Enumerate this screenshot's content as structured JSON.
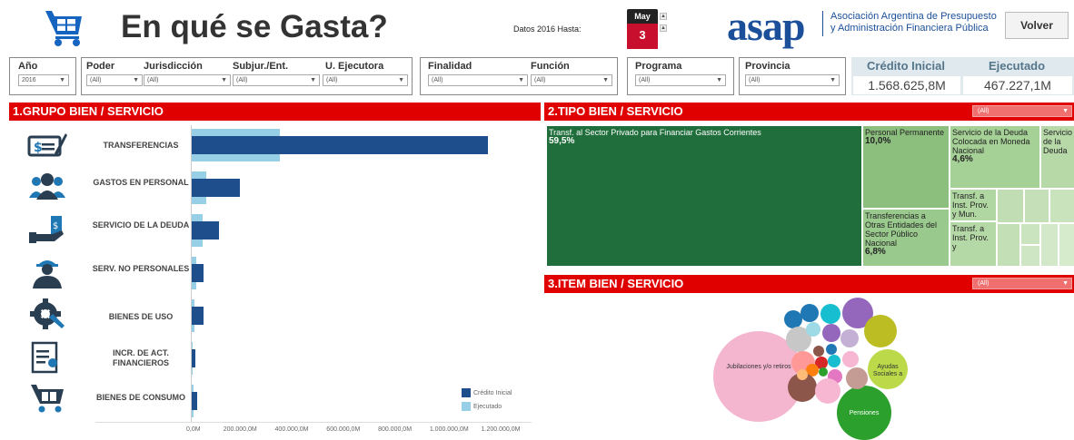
{
  "header": {
    "title": "En qué se Gasta?",
    "date_label": "Datos 2016 Hasta:",
    "calendar": {
      "month": "May",
      "day": "3"
    },
    "org_short": "asap",
    "org_line1": "Asociación Argentina de Presupuesto",
    "org_line2": "y Administración Financiera Pública",
    "back_button": "Volver"
  },
  "filters": {
    "anio": {
      "label": "Año",
      "value": "2016"
    },
    "poder": {
      "label": "Poder",
      "value": "(All)"
    },
    "jurisdiccion": {
      "label": "Jurisdicción",
      "value": "(All)"
    },
    "subjur": {
      "label": "Subjur./Ent.",
      "value": "(All)"
    },
    "uejecutora": {
      "label": "U. Ejecutora",
      "value": "(All)"
    },
    "finalidad": {
      "label": "Finalidad",
      "value": "(All)"
    },
    "funcion": {
      "label": "Función",
      "value": "(All)"
    },
    "programa": {
      "label": "Programa",
      "value": "(All)"
    },
    "provincia": {
      "label": "Provincia",
      "value": "(All)"
    }
  },
  "kpis": {
    "credito_label": "Crédito Inicial",
    "credito_value": "1.568.625,8M",
    "ejecutado_label": "Ejecutado",
    "ejecutado_value": "467.227,1M"
  },
  "section1": {
    "title": "1.GRUPO BIEN / SERVICIO",
    "categories": [
      {
        "label": "TRANSFERENCIAS",
        "icon": "check-icon"
      },
      {
        "label": "GASTOS EN PERSONAL",
        "icon": "people-icon"
      },
      {
        "label": "SERVICIO DE LA DEUDA",
        "icon": "money-hand-icon"
      },
      {
        "label": "SERV. NO PERSONALES",
        "icon": "worker-icon"
      },
      {
        "label": "BIENES DE USO",
        "icon": "gear-wrench-icon"
      },
      {
        "label": "INCR. DE ACT. FINANCIEROS",
        "icon": "certificate-icon"
      },
      {
        "label": "BIENES DE CONSUMO",
        "icon": "cart-icon"
      }
    ],
    "legend": {
      "credito": "Crédito Inicial",
      "ejecutado": "Ejecutado"
    },
    "colors": {
      "credito": "#1f4e8c",
      "ejecutado": "#97d0e6"
    }
  },
  "chart_data": {
    "type": "bar",
    "orientation": "horizontal",
    "categories": [
      "TRANSFERENCIAS",
      "GASTOS EN PERSONAL",
      "SERVICIO DE LA DEUDA",
      "SERV. NO PERSONALES",
      "BIENES DE USO",
      "INCR. DE ACT. FINANCIEROS",
      "BIENES DE CONSUMO"
    ],
    "series": [
      {
        "name": "Crédito Inicial",
        "values": [
          1150000,
          185000,
          105000,
          45000,
          45000,
          14000,
          20000
        ]
      },
      {
        "name": "Ejecutado",
        "values": [
          340000,
          58000,
          42000,
          16000,
          12000,
          4000,
          6000
        ]
      }
    ],
    "xlim": [
      0,
      1300000
    ],
    "xticks": [
      "0,0M",
      "200.000,0M",
      "400.000,0M",
      "600.000,0M",
      "800.000,0M",
      "1.000.000,0M",
      "1.200.000,0M"
    ],
    "xtick_values": [
      0,
      200000,
      400000,
      600000,
      800000,
      1000000,
      1200000
    ],
    "legend_position": "bottom-right"
  },
  "section2": {
    "title": "2.TIPO BIEN / SERVICIO",
    "dropdown": "(All)",
    "cells": [
      {
        "name": "Transf. al Sector Privado para Financiar Gastos Corrientes",
        "pct": "59,5%"
      },
      {
        "name": "Personal Permanente",
        "pct": "10,0%"
      },
      {
        "name": "Servicio de la Deuda Colocada en Moneda Nacional",
        "pct": "4,6%"
      },
      {
        "name": "Servicio de la Deuda",
        "pct": ""
      },
      {
        "name": "Transferencias a Otras Entidades del Sector Público Nacional",
        "pct": "6,8%"
      },
      {
        "name": "Transf. a Inst. Prov. y Mun. para",
        "pct": ""
      },
      {
        "name": "Transf. a Inst. Prov. y",
        "pct": ""
      }
    ]
  },
  "section3": {
    "title": "3.ITEM BIEN / SERVICIO",
    "dropdown": "(All)",
    "labels": {
      "jubilaciones": "Jubilaciones y/o retiros",
      "ayudas": "Ayudas Sociales a",
      "pensiones": "Pensiones"
    }
  }
}
